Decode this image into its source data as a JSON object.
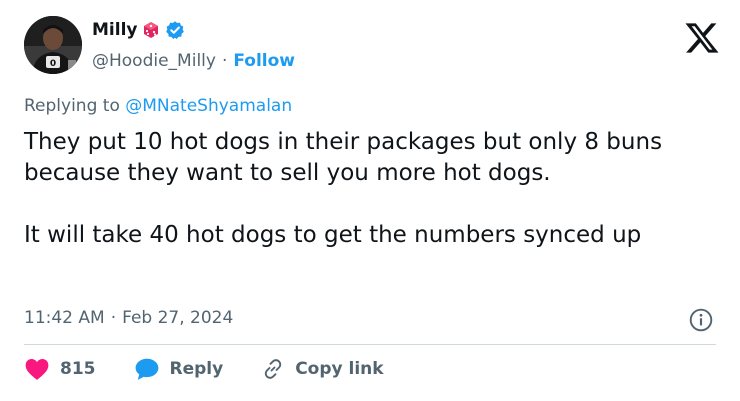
{
  "author": {
    "name": "Milly",
    "handle": "@Hoodie_Milly",
    "separator": "·",
    "follow_label": "Follow",
    "icons": [
      "die-icon",
      "verified-icon"
    ]
  },
  "platform_icon": "x-logo-icon",
  "reply_context": {
    "prefix": "Replying to",
    "mention": "@MNateShyamalan"
  },
  "tweet": {
    "paragraph1": "They put 10 hot dogs in their packages but only 8 buns because they want to sell you more hot dogs.",
    "paragraph2": "It will take 40 hot dogs to get the numbers synced up"
  },
  "meta": {
    "time": "11:42 AM",
    "separator": "·",
    "date": "Feb 27, 2024"
  },
  "actions": {
    "like_count": "815",
    "reply_label": "Reply",
    "copy_link_label": "Copy link"
  },
  "colors": {
    "accent": "#1d9bf0",
    "like": "#f91880",
    "muted": "#536471",
    "text": "#0f1419",
    "divider": "#cfd9de"
  }
}
